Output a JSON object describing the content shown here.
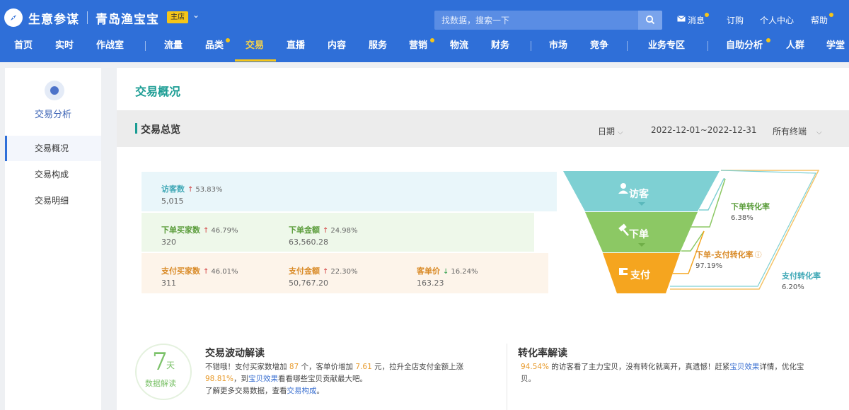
{
  "header": {
    "brand": "生意参谋",
    "shop_name": "青岛渔宝宝",
    "shop_badge": "主店",
    "search_placeholder": "找数据，搜索一下",
    "links": [
      "消息",
      "订购",
      "个人中心",
      "帮助"
    ]
  },
  "nav": {
    "items": [
      "首页",
      "实时",
      "作战室",
      "流量",
      "品类",
      "交易",
      "直播",
      "内容",
      "服务",
      "营销",
      "物流",
      "财务",
      "市场",
      "竞争",
      "业务专区",
      "自助分析",
      "人群",
      "学堂"
    ],
    "active": "交易"
  },
  "sidebar": {
    "title": "交易分析",
    "items": [
      "交易概况",
      "交易构成",
      "交易明细"
    ]
  },
  "main": {
    "title": "交易概况",
    "overview_title": "交易总览",
    "date_label": "日期",
    "date_range": "2022-12-01~2022-12-31",
    "terminal": "所有终端"
  },
  "metrics": {
    "visitors": {
      "label": "访客数",
      "change": "53.83%",
      "value": "5,015"
    },
    "order_buyers": {
      "label": "下单买家数",
      "change": "46.79%",
      "value": "320"
    },
    "order_amount": {
      "label": "下单金额",
      "change": "24.98%",
      "value": "63,560.28"
    },
    "pay_buyers": {
      "label": "支付买家数",
      "change": "46.01%",
      "value": "311"
    },
    "pay_amount": {
      "label": "支付金额",
      "change": "22.30%",
      "value": "50,767.20"
    },
    "unit_price": {
      "label": "客单价",
      "change": "16.24%",
      "value": "163.23"
    }
  },
  "funnel": {
    "stages": [
      "访客",
      "下单",
      "支付"
    ],
    "order_rate": {
      "label": "下单转化率",
      "value": "6.38%"
    },
    "order_pay_rate": {
      "label": "下单-支付转化率",
      "value": "97.19%"
    },
    "pay_rate": {
      "label": "支付转化率",
      "value": "6.20%"
    },
    "colors": {
      "visit": "#7ed0d3",
      "order": "#8cc864",
      "pay": "#f5a51f"
    }
  },
  "bottom": {
    "badge_num": "7",
    "badge_unit": "天",
    "badge_sub": "数据解读",
    "wave_title": "交易波动解读",
    "wave_p1": "不错哦！支付买家数增加",
    "wave_n1": "87",
    "wave_p2": "个，客单价增加",
    "wave_n2": "7.61",
    "wave_p3": "元，拉升全店支付金额上涨",
    "wave_n3": "98.81%",
    "wave_p4": "，到",
    "wave_link1": "宝贝效果",
    "wave_p5": "看看哪些宝贝贡献最大吧。",
    "wave_p6": "了解更多交易数据，查看",
    "wave_link2": "交易构成",
    "wave_p7": "。",
    "conv_title": "转化率解读",
    "conv_n1": "94.54%",
    "conv_p1": "的访客看了主力宝贝，没有转化就离开，真遗憾！赶紧",
    "conv_link": "宝贝效果",
    "conv_p2": "详情，优化宝贝。"
  }
}
